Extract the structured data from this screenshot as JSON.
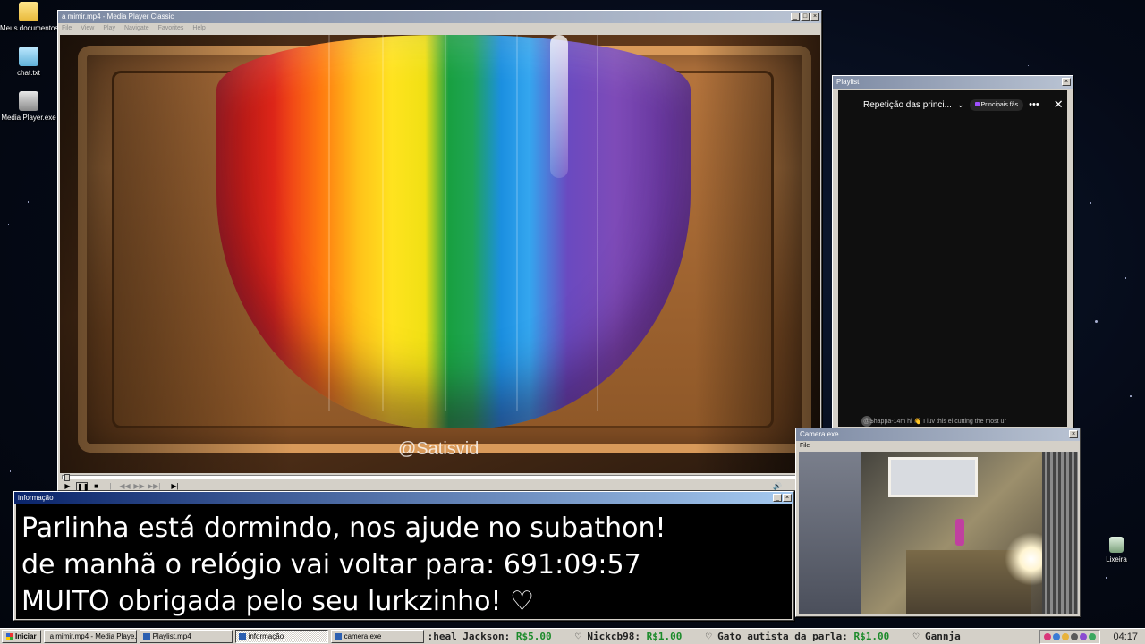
{
  "desktop": {
    "icons": [
      {
        "label": "Meus documentos",
        "icon": "folder-icon"
      },
      {
        "label": "chat.txt",
        "icon": "notepad-icon"
      },
      {
        "label": "Media Player.exe",
        "icon": "media-player-icon"
      }
    ],
    "recycle_bin": {
      "label": "Lixeira",
      "icon": "recycle-bin-icon"
    }
  },
  "media_player": {
    "title": "a mimir.mp4 - Media Player Classic",
    "menu": [
      "File",
      "View",
      "Play",
      "Navigate",
      "Favorites",
      "Help"
    ],
    "watermark": "@Satisvid",
    "seek_progress": 0.0
  },
  "playlist": {
    "title": "Playlist",
    "chat_title": "Repetição das princi...",
    "chat_filter": "Principais fãs",
    "last_message": "@Shappa-14m  hi 👋 I luv this ei cutting the most ur"
  },
  "camera": {
    "title": "Camera.exe",
    "menu": [
      "File"
    ]
  },
  "info": {
    "title": "informação",
    "line1": "Parlinha está dormindo, nos ajude no subathon!",
    "line2": "de manhã o relógio vai voltar para:  691:09:57",
    "line3": "MUITO obrigada pelo seu lurkzinho! ♡"
  },
  "taskbar": {
    "start_label": "Iniciar",
    "tasks": [
      {
        "label": "a mimir.mp4 - Media Playe..."
      },
      {
        "label": "Playlist.mp4"
      },
      {
        "label": "informação"
      },
      {
        "label": "camera.exe"
      }
    ],
    "ticker": [
      {
        "name": ":heal Jackson:",
        "amount": "R$5.00"
      },
      {
        "name": "♡ Nickcb98:",
        "amount": "R$1.00"
      },
      {
        "name": "♡ Gato autista da parla:",
        "amount": "R$1.00"
      },
      {
        "name": "♡ Gannja",
        "amount": ""
      }
    ],
    "clock": "04:17"
  }
}
